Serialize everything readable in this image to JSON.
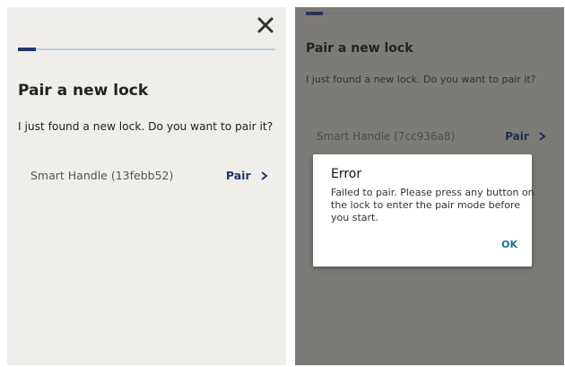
{
  "left_screen": {
    "title": "Pair a new lock",
    "subtitle": "I just found a new lock. Do you want to pair it?",
    "device": {
      "name": "Smart Handle (13febb52)",
      "action_label": "Pair"
    },
    "progress": 0.07,
    "close_icon": "close-icon"
  },
  "right_screen": {
    "title": "Pair a new lock",
    "subtitle": "I just found a new lock. Do you want to pair it?",
    "device": {
      "name": "Smart Handle (7cc936a8)",
      "action_label": "Pair"
    },
    "progress": 0.07,
    "dialog": {
      "title": "Error",
      "message": "Failed to pair. Please press any button on the lock to enter the pair mode before you start.",
      "ok_label": "OK"
    }
  },
  "colors": {
    "accent": "#1f3a63",
    "dialog_ok": "#1f6f8b",
    "background": "#f0eeea",
    "overlay": "#7d7b78"
  }
}
